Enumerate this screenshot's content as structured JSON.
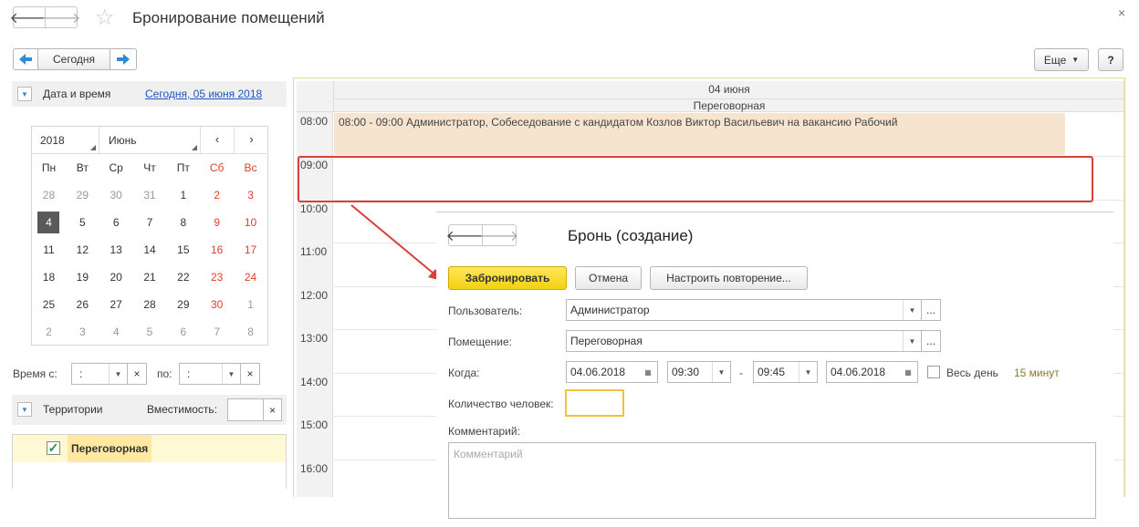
{
  "window": {
    "title": "Бронирование помещений"
  },
  "toolbar": {
    "today_label": "Сегодня",
    "more_label": "Еще",
    "help_label": "?"
  },
  "date_section": {
    "label": "Дата и время",
    "today_link": "Сегодня, 05 июня 2018"
  },
  "calendar": {
    "year": "2018",
    "month": "Июнь",
    "weekdays": [
      "Пн",
      "Вт",
      "Ср",
      "Чт",
      "Пт",
      "Сб",
      "Вс"
    ],
    "weeks": [
      [
        "28",
        "29",
        "30",
        "31",
        "1",
        "2",
        "3"
      ],
      [
        "4",
        "5",
        "6",
        "7",
        "8",
        "9",
        "10"
      ],
      [
        "11",
        "12",
        "13",
        "14",
        "15",
        "16",
        "17"
      ],
      [
        "18",
        "19",
        "20",
        "21",
        "22",
        "23",
        "24"
      ],
      [
        "25",
        "26",
        "27",
        "28",
        "29",
        "30",
        "1"
      ],
      [
        "2",
        "3",
        "4",
        "5",
        "6",
        "7",
        "8"
      ]
    ],
    "selected_day": "4"
  },
  "time_filter": {
    "from_label": "Время с:",
    "to_label": "по:",
    "from_value": ":",
    "to_value": ":"
  },
  "territories": {
    "label": "Территории",
    "capacity_label": "Вместимость:",
    "items": [
      {
        "name": "Переговорная",
        "checked": true
      }
    ]
  },
  "schedule": {
    "date_header": "04 июня",
    "room_header": "Переговорная",
    "hours": [
      "08:00",
      "09:00",
      "10:00",
      "11:00",
      "12:00",
      "13:00",
      "14:00",
      "15:00",
      "16:00"
    ],
    "event_text": "08:00 - 09:00 Администратор, Собеседование с кандидатом Козлов Виктор Васильевич на вакансию Рабочий"
  },
  "booking_form": {
    "title": "Бронь (создание)",
    "book_button": "Забронировать",
    "cancel_button": "Отмена",
    "repeat_button": "Настроить повторение...",
    "user_label": "Пользователь:",
    "user_value": "Администратор",
    "room_label": "Помещение:",
    "room_value": "Переговорная",
    "when_label": "Когда:",
    "date_from": "04.06.2018",
    "time_from": "09:30",
    "dash": "-",
    "time_to": "09:45",
    "date_to": "04.06.2018",
    "all_day_label": "Весь день",
    "duration": "15 минут",
    "people_label": "Количество человек:",
    "comment_label": "Комментарий:",
    "comment_placeholder": "Комментарий"
  }
}
